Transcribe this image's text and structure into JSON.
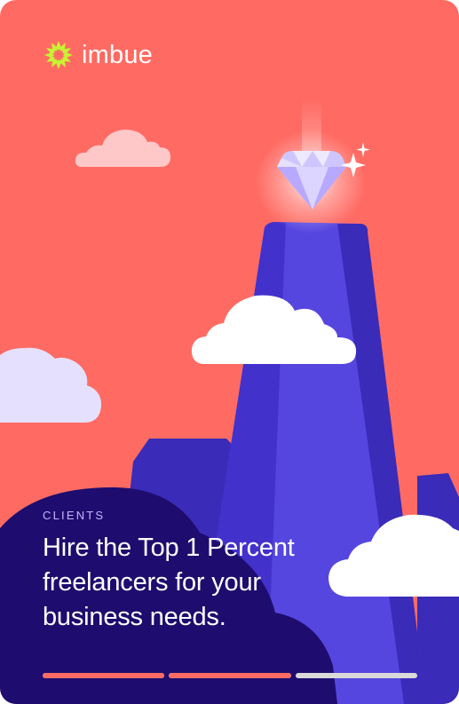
{
  "brand": {
    "name": "imbue",
    "logo_icon": "sun-burst-icon",
    "accent_color": "#C6F432"
  },
  "colors": {
    "background": "#FF6B63",
    "mountain": "#5646E0",
    "mountain_shadow": "#3A2BB8",
    "panel": "#1E0D6E",
    "progress_active": "#FF6B63",
    "progress_inactive": "#D9D9D9"
  },
  "slide": {
    "eyebrow": "CLIENTS",
    "headline_lines": [
      "Hire the Top 1 Percent",
      "freelancers for your",
      "business needs."
    ]
  },
  "progress": [
    {
      "fill": 1.0,
      "color": "#FF6B63"
    },
    {
      "fill": 1.0,
      "color": "#FF6B63"
    },
    {
      "fill": 0.0,
      "color": "#FF6B63"
    }
  ],
  "illustration": {
    "icons": [
      "diamond-icon",
      "sparkle-icon",
      "mountain-illustration",
      "cloud-icon"
    ]
  }
}
